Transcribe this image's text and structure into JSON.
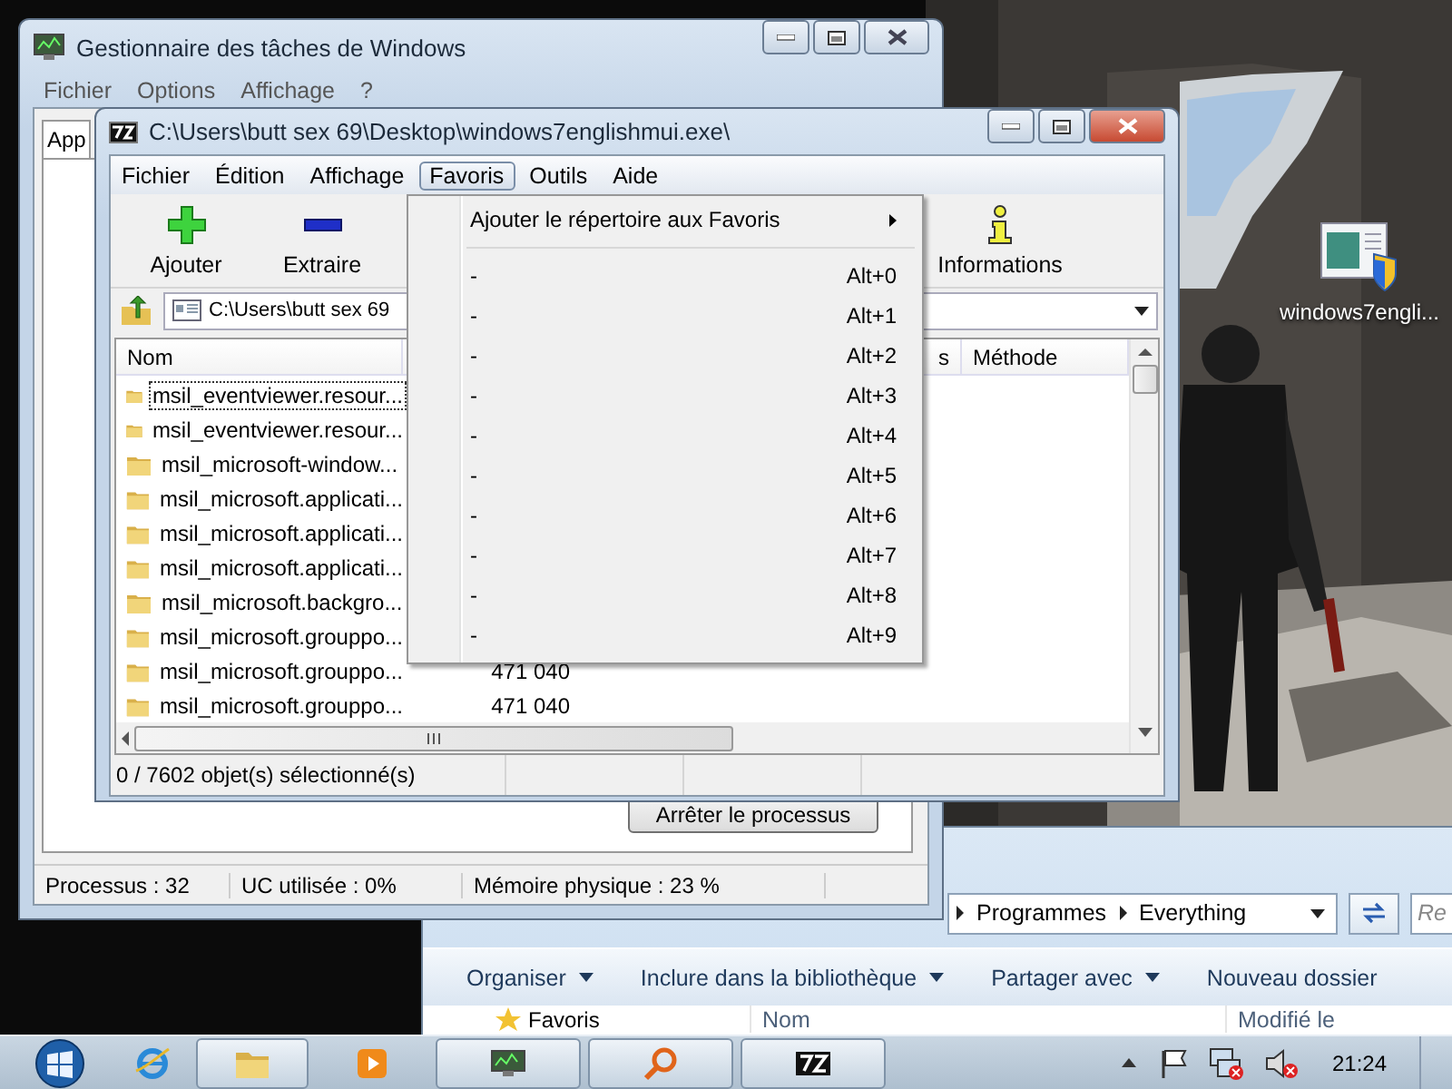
{
  "desktop": {
    "icon": {
      "label": "windows7engli..."
    }
  },
  "task_manager": {
    "title": "Gestionnaire des tâches de Windows",
    "menu": [
      "Fichier",
      "Options",
      "Affichage",
      "?"
    ],
    "tabs": [
      {
        "label": "App",
        "selected": true
      }
    ],
    "end_button": "Arrêter le processus",
    "status_bar": [
      "Processus : 32",
      "UC utilisée : 0%",
      "Mémoire physique : 23 %"
    ]
  },
  "archive_window": {
    "title": "C:\\Users\\butt sex 69\\Desktop\\windows7englishmui.exe\\",
    "menu": [
      {
        "label": "Fichier",
        "selected": false
      },
      {
        "label": "Édition",
        "selected": false
      },
      {
        "label": "Affichage",
        "selected": false
      },
      {
        "label": "Favoris",
        "selected": true
      },
      {
        "label": "Outils",
        "selected": false
      },
      {
        "label": "Aide",
        "selected": false
      }
    ],
    "toolbar": [
      {
        "kind": "add",
        "label": "Ajouter"
      },
      {
        "kind": "extract",
        "label": "Extraire"
      },
      {
        "kind": "info",
        "label": "Informations"
      }
    ],
    "path": "C:\\Users\\butt sex 69",
    "columns": [
      "Nom",
      "s",
      "Méthode"
    ],
    "rows": [
      {
        "name": "msil_eventviewer.resour...",
        "focused": true
      },
      {
        "name": "msil_eventviewer.resour...",
        "focused": false
      },
      {
        "name": "msil_microsoft-window...",
        "focused": false
      },
      {
        "name": "msil_microsoft.applicati...",
        "focused": false
      },
      {
        "name": "msil_microsoft.applicati...",
        "focused": false
      },
      {
        "name": "msil_microsoft.applicati...",
        "focused": false
      },
      {
        "name": "msil_microsoft.backgro...",
        "focused": false
      },
      {
        "name": "msil_microsoft.grouppo...",
        "focused": false
      },
      {
        "name": "msil_microsoft.grouppo...",
        "size": "471 040",
        "focused": false
      },
      {
        "name": "msil_microsoft.grouppo...",
        "size": "471 040",
        "focused": false
      }
    ],
    "status_bar": "0 / 7602 objet(s) sélectionné(s)"
  },
  "favorites_menu": {
    "items": [
      {
        "kind": "submenu",
        "label": "Ajouter le répertoire aux Favoris"
      },
      {
        "kind": "separator"
      },
      {
        "kind": "entry",
        "label": "-",
        "shortcut": "Alt+0"
      },
      {
        "kind": "entry",
        "label": "-",
        "shortcut": "Alt+1"
      },
      {
        "kind": "entry",
        "label": "-",
        "shortcut": "Alt+2"
      },
      {
        "kind": "entry",
        "label": "-",
        "shortcut": "Alt+3"
      },
      {
        "kind": "entry",
        "label": "-",
        "shortcut": "Alt+4"
      },
      {
        "kind": "entry",
        "label": "-",
        "shortcut": "Alt+5"
      },
      {
        "kind": "entry",
        "label": "-",
        "shortcut": "Alt+6"
      },
      {
        "kind": "entry",
        "label": "-",
        "shortcut": "Alt+7"
      },
      {
        "kind": "entry",
        "label": "-",
        "shortcut": "Alt+8"
      },
      {
        "kind": "entry",
        "label": "-",
        "shortcut": "Alt+9"
      }
    ]
  },
  "explorer": {
    "breadcrumb": [
      "Programmes",
      "Everything"
    ],
    "search": {
      "placeholder": "Re"
    },
    "toolbar": [
      {
        "label": "Organiser",
        "dropdown": true
      },
      {
        "label": "Inclure dans la bibliothèque",
        "dropdown": true
      },
      {
        "label": "Partager avec",
        "dropdown": true
      },
      {
        "label": "Nouveau dossier",
        "dropdown": false
      }
    ],
    "columns": [
      "Nom",
      "Modifié le"
    ],
    "sidebar": [
      "Favoris"
    ]
  },
  "taskbar": {
    "clock": "21:24"
  }
}
